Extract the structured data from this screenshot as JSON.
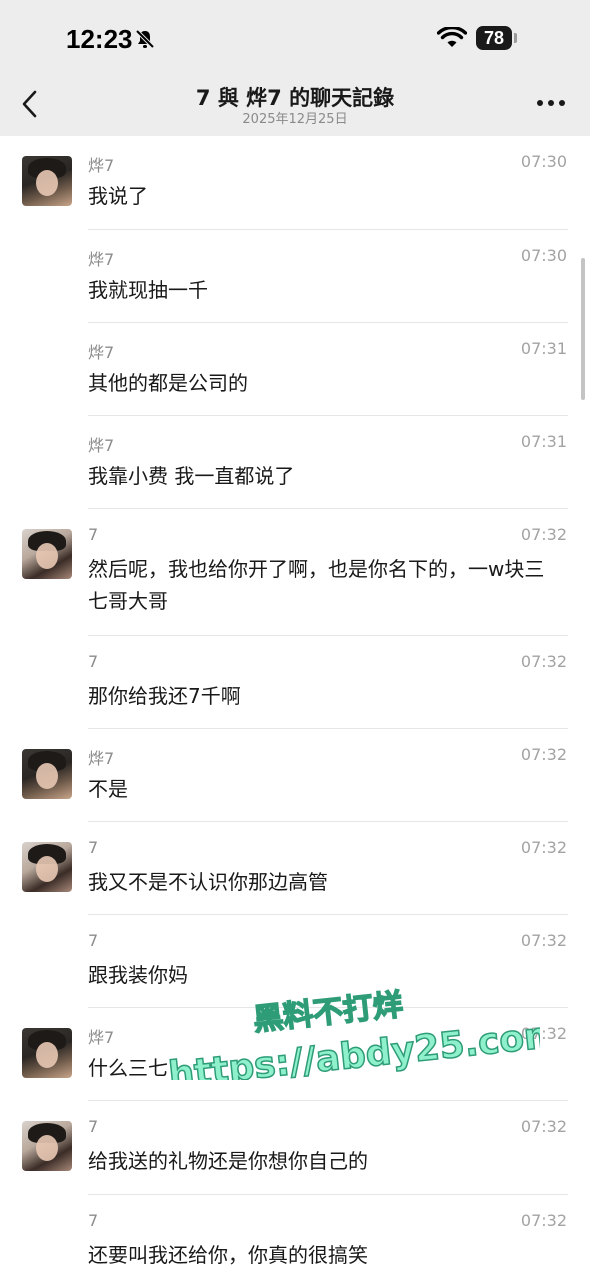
{
  "status_bar": {
    "time": "12:23",
    "battery": "78"
  },
  "nav": {
    "title": "7 與 烨7 的聊天記錄",
    "subtitle": "2025年12月25日"
  },
  "messages": [
    {
      "sender": "烨7",
      "time": "07:30",
      "text": "我说了",
      "avatar": "male"
    },
    {
      "sender": "烨7",
      "time": "07:30",
      "text": "我就现抽一千",
      "avatar": null
    },
    {
      "sender": "烨7",
      "time": "07:31",
      "text": "其他的都是公司的",
      "avatar": null
    },
    {
      "sender": "烨7",
      "time": "07:31",
      "text": "我靠小费 我一直都说了",
      "avatar": null
    },
    {
      "sender": "7",
      "time": "07:32",
      "text": "然后呢，我也给你开了啊，也是你名下的，一w块三七哥大哥",
      "avatar": "female"
    },
    {
      "sender": "7",
      "time": "07:32",
      "text": "那你给我还7千啊",
      "avatar": null
    },
    {
      "sender": "烨7",
      "time": "07:32",
      "text": "不是",
      "avatar": "male"
    },
    {
      "sender": "7",
      "time": "07:32",
      "text": "我又不是不认识你那边高管",
      "avatar": "female"
    },
    {
      "sender": "7",
      "time": "07:32",
      "text": "跟我装你妈",
      "avatar": null
    },
    {
      "sender": "烨7",
      "time": "07:32",
      "text": "什么三七",
      "avatar": "male"
    },
    {
      "sender": "7",
      "time": "07:32",
      "text": "给我送的礼物还是你想你自己的",
      "avatar": "female"
    },
    {
      "sender": "7",
      "time": "07:32",
      "text": "还要叫我还给你，你真的很搞笑",
      "avatar": null
    }
  ],
  "watermark": {
    "line1": "黑料不打烊",
    "line2": "https://abdy25.com"
  }
}
